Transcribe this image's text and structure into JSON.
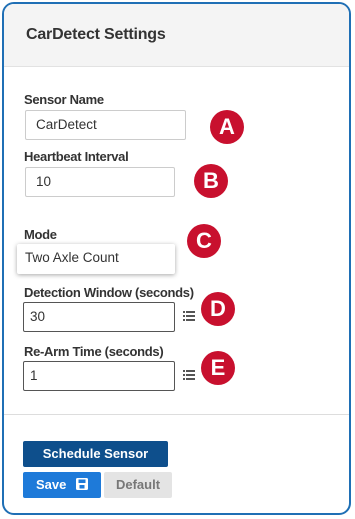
{
  "colors": {
    "accent": "#1f6fb5",
    "badge": "#c8102e",
    "schedule": "#0e4f8c",
    "save": "#1e7ad9"
  },
  "header": {
    "title": "CarDetect Settings"
  },
  "fields": {
    "sensor_name": {
      "label": "Sensor Name",
      "value": "CarDetect"
    },
    "heartbeat": {
      "label": "Heartbeat Interval",
      "value": "10"
    },
    "mode": {
      "label": "Mode",
      "value": "Two Axle Count"
    },
    "detection_window": {
      "label": "Detection Window (seconds)",
      "value": "30"
    },
    "rearm_time": {
      "label": "Re-Arm Time (seconds)",
      "value": "1"
    }
  },
  "callouts": [
    "A",
    "B",
    "C",
    "D",
    "E"
  ],
  "buttons": {
    "schedule": "Schedule Sensor",
    "save": "Save",
    "default": "Default"
  },
  "icons": {
    "list": "list-icon",
    "save": "floppy-disk-icon"
  }
}
